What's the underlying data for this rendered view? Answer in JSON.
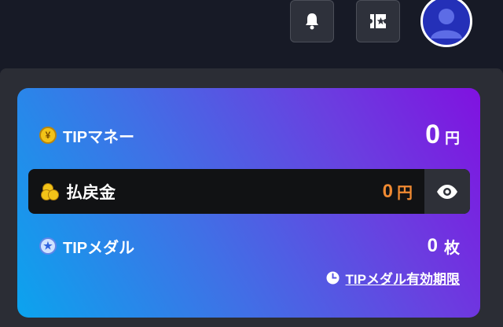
{
  "header": {
    "notifications_icon": "bell-icon",
    "tickets_icon": "ticket-star-icon",
    "avatar_icon": "user-avatar"
  },
  "wallet": {
    "tip_money": {
      "label": "TIPマネー",
      "icon": "yen-coin-icon",
      "coin_glyph": "¥",
      "value": "0",
      "unit": "円"
    },
    "refund": {
      "label": "払戻金",
      "icon": "coin-stack-icon",
      "value": "0",
      "unit": "円",
      "toggle_icon": "eye-icon"
    },
    "tip_medal": {
      "label": "TIPメダル",
      "icon": "star-medal-icon",
      "star_glyph": "★",
      "value": "0",
      "unit": "枚"
    },
    "expiry_link": {
      "label": "TIPメダル有効期限",
      "icon": "clock-icon"
    }
  },
  "colors": {
    "background": "#171a26",
    "panel": "#2b2d35",
    "card_gradient_start": "#0ba4ee",
    "card_gradient_end": "#8012e0",
    "refund_value": "#f08a32",
    "avatar": "#2430b8"
  }
}
